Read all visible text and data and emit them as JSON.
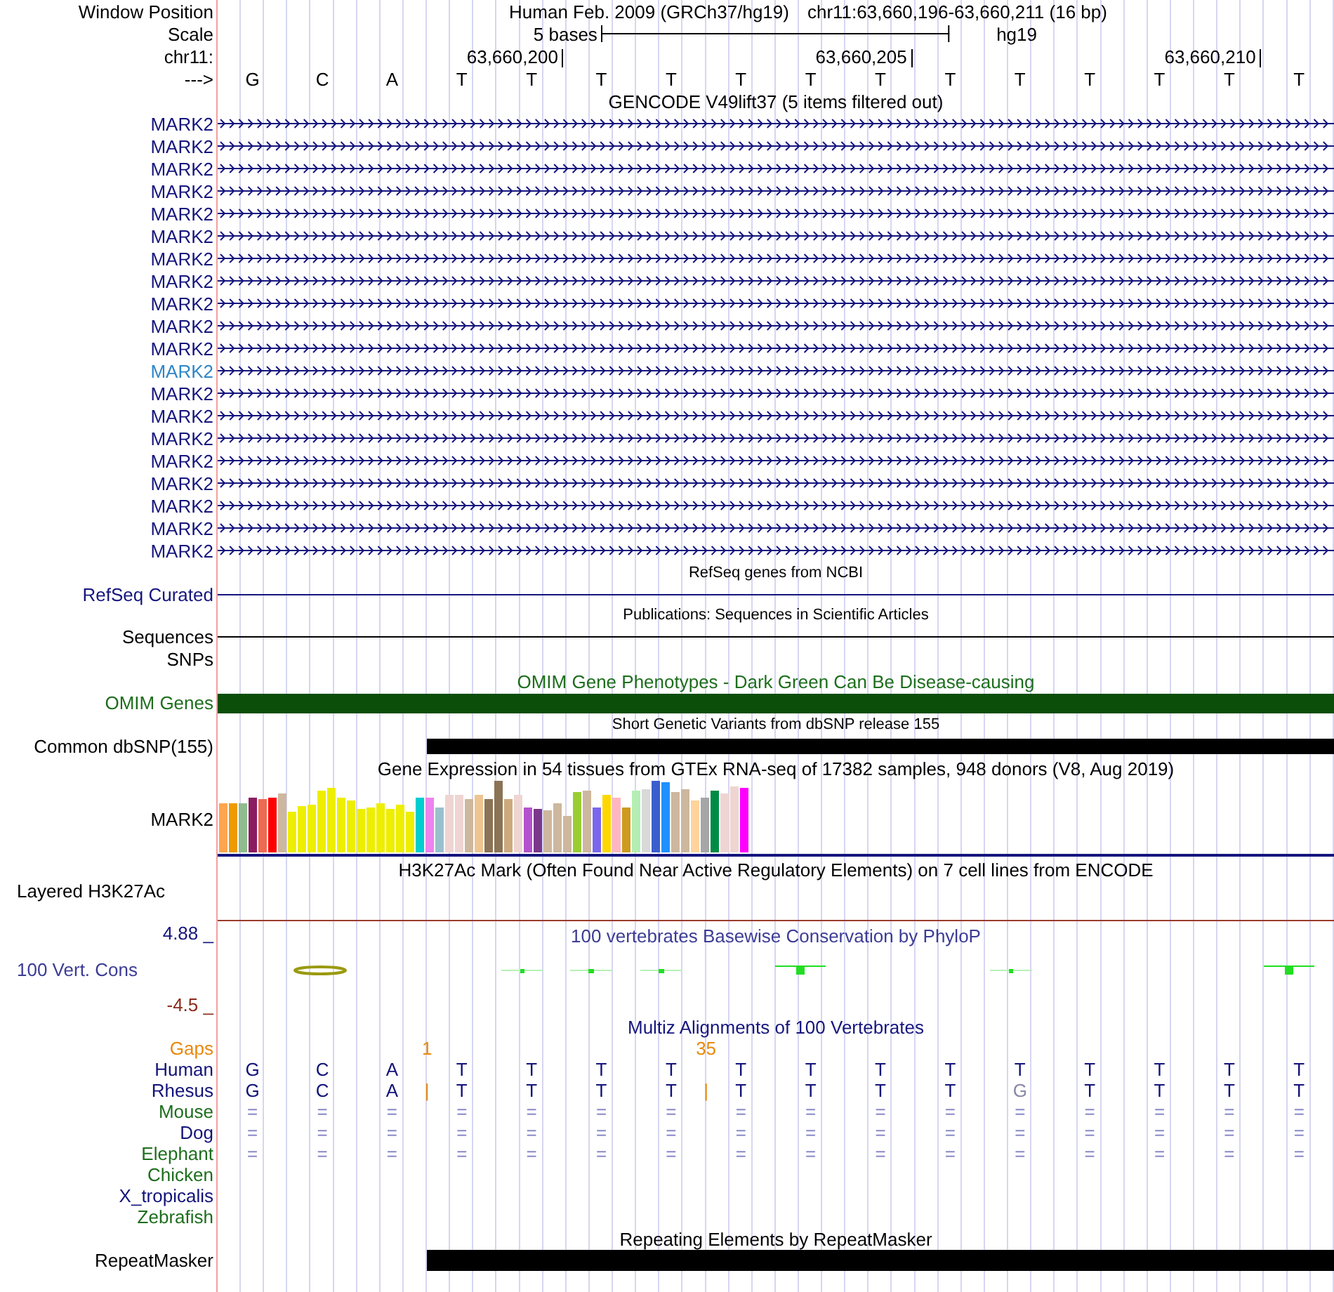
{
  "header": {
    "position_label": "Window Position",
    "assembly_name": "Human Feb. 2009 (GRCh37/hg19)",
    "position": "chr11:63,660,196-63,660,211 (16 bp)",
    "scale_label": "Scale",
    "scale": "5 bases",
    "assembly": "hg19",
    "chrom_label": "chr11:",
    "ruler_ticks": [
      "63,660,200",
      "63,660,205",
      "63,660,210"
    ],
    "strand_label": "--->",
    "bases": [
      "G",
      "C",
      "A",
      "T",
      "T",
      "T",
      "T",
      "T",
      "T",
      "T",
      "T",
      "T",
      "T",
      "T",
      "T",
      "T"
    ]
  },
  "gencode": {
    "title": "GENCODE V49lift37 (5 items filtered out)",
    "items": [
      {
        "label": "MARK2",
        "selected": false
      },
      {
        "label": "MARK2",
        "selected": false
      },
      {
        "label": "MARK2",
        "selected": false
      },
      {
        "label": "MARK2",
        "selected": false
      },
      {
        "label": "MARK2",
        "selected": false
      },
      {
        "label": "MARK2",
        "selected": false
      },
      {
        "label": "MARK2",
        "selected": false
      },
      {
        "label": "MARK2",
        "selected": false
      },
      {
        "label": "MARK2",
        "selected": false
      },
      {
        "label": "MARK2",
        "selected": false
      },
      {
        "label": "MARK2",
        "selected": false
      },
      {
        "label": "MARK2",
        "selected": true
      },
      {
        "label": "MARK2",
        "selected": false
      },
      {
        "label": "MARK2",
        "selected": false
      },
      {
        "label": "MARK2",
        "selected": false
      },
      {
        "label": "MARK2",
        "selected": false
      },
      {
        "label": "MARK2",
        "selected": false
      },
      {
        "label": "MARK2",
        "selected": false
      },
      {
        "label": "MARK2",
        "selected": false
      },
      {
        "label": "MARK2",
        "selected": false
      }
    ]
  },
  "refseq": {
    "title": "RefSeq genes from NCBI",
    "label": "RefSeq Curated"
  },
  "publications": {
    "title": "Publications: Sequences in Scientific Articles",
    "label": "Sequences"
  },
  "snps": {
    "label": "SNPs"
  },
  "omim": {
    "title": "OMIM Gene Phenotypes - Dark Green Can Be Disease-causing",
    "label": "OMIM Genes"
  },
  "dbsnp": {
    "title": "Short Genetic Variants from dbSNP release 155",
    "label": "Common dbSNP(155)"
  },
  "gtex": {
    "title": "Gene Expression in 54 tissues from GTEx RNA-seq of 17382 samples, 948 donors (V8, Aug 2019)",
    "label": "MARK2"
  },
  "h3k27ac": {
    "title": "H3K27Ac Mark (Often Found Near Active Regulatory Elements) on 7 cell lines from ENCODE",
    "label": "Layered H3K27Ac"
  },
  "phylop": {
    "title": "100 vertebrates Basewise Conservation by PhyloP",
    "label": "100 Vert. Cons",
    "ymax": "4.88 _",
    "ymin": "-4.5 _"
  },
  "multiz": {
    "title": "Multiz Alignments of 100 Vertebrates",
    "rows": [
      {
        "name": "Gaps",
        "color": "#e8890c",
        "cells": [
          {
            "kind": "blank"
          },
          {
            "kind": "blank"
          },
          {
            "kind": "blank"
          },
          {
            "kind": "insertion",
            "text": "1"
          },
          {
            "kind": "blank"
          },
          {
            "kind": "blank"
          },
          {
            "kind": "blank"
          },
          {
            "kind": "blank"
          },
          {
            "kind": "insertion",
            "text": "35"
          }
        ]
      },
      {
        "name": "Human",
        "color": "#12127a",
        "cells": [
          {
            "kind": "base",
            "text": "G"
          },
          {
            "kind": "base",
            "text": "C"
          },
          {
            "kind": "base",
            "text": "A"
          },
          {
            "kind": "spacer"
          },
          {
            "kind": "base",
            "text": "T"
          },
          {
            "kind": "base",
            "text": "T"
          },
          {
            "kind": "base",
            "text": "T"
          },
          {
            "kind": "base",
            "text": "T"
          },
          {
            "kind": "spacer"
          },
          {
            "kind": "base",
            "text": "T"
          },
          {
            "kind": "base",
            "text": "T"
          },
          {
            "kind": "base",
            "text": "T"
          },
          {
            "kind": "base",
            "text": "T"
          },
          {
            "kind": "base",
            "text": "T"
          },
          {
            "kind": "base",
            "text": "T"
          },
          {
            "kind": "base",
            "text": "T"
          },
          {
            "kind": "base",
            "text": "T"
          },
          {
            "kind": "base",
            "text": "T"
          }
        ]
      },
      {
        "name": "Rhesus",
        "color": "#12127a",
        "cells": [
          {
            "kind": "base",
            "text": "G"
          },
          {
            "kind": "base",
            "text": "C"
          },
          {
            "kind": "base",
            "text": "A"
          },
          {
            "kind": "insertion",
            "text": "|"
          },
          {
            "kind": "base",
            "text": "T"
          },
          {
            "kind": "base",
            "text": "T"
          },
          {
            "kind": "base",
            "text": "T"
          },
          {
            "kind": "base",
            "text": "T"
          },
          {
            "kind": "insertion",
            "text": "|"
          },
          {
            "kind": "base",
            "text": "T"
          },
          {
            "kind": "base",
            "text": "T"
          },
          {
            "kind": "base",
            "text": "T"
          },
          {
            "kind": "base",
            "text": "T"
          },
          {
            "kind": "mismatch",
            "text": "G"
          },
          {
            "kind": "base",
            "text": "T"
          },
          {
            "kind": "base",
            "text": "T"
          },
          {
            "kind": "base",
            "text": "T"
          },
          {
            "kind": "base",
            "text": "T"
          }
        ]
      },
      {
        "name": "Mouse",
        "color": "#1d6e1d",
        "cells": [
          {
            "kind": "identical",
            "text": "="
          },
          {
            "kind": "identical",
            "text": "="
          },
          {
            "kind": "identical",
            "text": "="
          },
          {
            "kind": "spacer"
          },
          {
            "kind": "identical",
            "text": "="
          },
          {
            "kind": "identical",
            "text": "="
          },
          {
            "kind": "identical",
            "text": "="
          },
          {
            "kind": "identical",
            "text": "="
          },
          {
            "kind": "spacer"
          },
          {
            "kind": "identical",
            "text": "="
          },
          {
            "kind": "identical",
            "text": "="
          },
          {
            "kind": "identical",
            "text": "="
          },
          {
            "kind": "identical",
            "text": "="
          },
          {
            "kind": "identical",
            "text": "="
          },
          {
            "kind": "identical",
            "text": "="
          },
          {
            "kind": "identical",
            "text": "="
          },
          {
            "kind": "identical",
            "text": "="
          },
          {
            "kind": "identical",
            "text": "="
          }
        ]
      },
      {
        "name": "Dog",
        "color": "#12127a",
        "cells": [
          {
            "kind": "identical",
            "text": "="
          },
          {
            "kind": "identical",
            "text": "="
          },
          {
            "kind": "identical",
            "text": "="
          },
          {
            "kind": "spacer"
          },
          {
            "kind": "identical",
            "text": "="
          },
          {
            "kind": "identical",
            "text": "="
          },
          {
            "kind": "identical",
            "text": "="
          },
          {
            "kind": "identical",
            "text": "="
          },
          {
            "kind": "spacer"
          },
          {
            "kind": "identical",
            "text": "="
          },
          {
            "kind": "identical",
            "text": "="
          },
          {
            "kind": "identical",
            "text": "="
          },
          {
            "kind": "identical",
            "text": "="
          },
          {
            "kind": "identical",
            "text": "="
          },
          {
            "kind": "identical",
            "text": "="
          },
          {
            "kind": "identical",
            "text": "="
          },
          {
            "kind": "identical",
            "text": "="
          },
          {
            "kind": "identical",
            "text": "="
          }
        ]
      },
      {
        "name": "Elephant",
        "color": "#1d6e1d",
        "cells": [
          {
            "kind": "identical",
            "text": "="
          },
          {
            "kind": "identical",
            "text": "="
          },
          {
            "kind": "identical",
            "text": "="
          },
          {
            "kind": "spacer"
          },
          {
            "kind": "identical",
            "text": "="
          },
          {
            "kind": "identical",
            "text": "="
          },
          {
            "kind": "identical",
            "text": "="
          },
          {
            "kind": "identical",
            "text": "="
          },
          {
            "kind": "spacer"
          },
          {
            "kind": "identical",
            "text": "="
          },
          {
            "kind": "identical",
            "text": "="
          },
          {
            "kind": "identical",
            "text": "="
          },
          {
            "kind": "identical",
            "text": "="
          },
          {
            "kind": "identical",
            "text": "="
          },
          {
            "kind": "identical",
            "text": "="
          },
          {
            "kind": "identical",
            "text": "="
          },
          {
            "kind": "identical",
            "text": "="
          },
          {
            "kind": "identical",
            "text": "="
          }
        ]
      },
      {
        "name": "Chicken",
        "color": "#1d6e1d"
      },
      {
        "name": "X_tropicalis",
        "color": "#12127a"
      },
      {
        "name": "Zebrafish",
        "color": "#1d6e1d"
      }
    ]
  },
  "repeatmasker": {
    "title": "Repeating Elements by RepeatMasker",
    "label": "RepeatMasker"
  }
}
